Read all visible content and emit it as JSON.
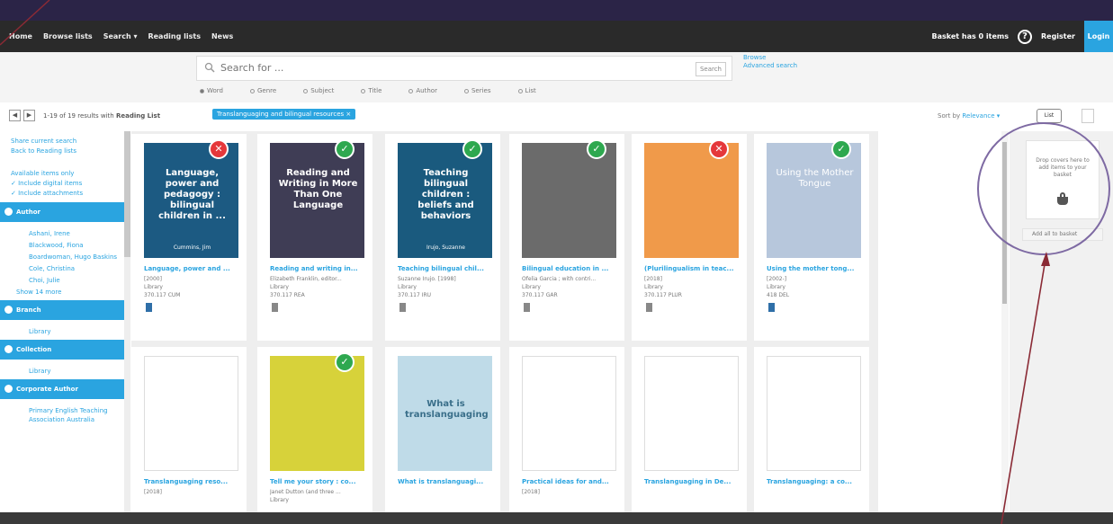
{
  "nav": {
    "home": "Home",
    "browse_lists": "Browse lists",
    "search": "Search ▾",
    "reading_lists": "Reading lists",
    "news": "News",
    "basket": "Basket has 0 items",
    "register": "Register",
    "login": "Login"
  },
  "search": {
    "placeholder": "Search for ...",
    "button": "Search",
    "browse": "Browse",
    "advanced": "Advanced search",
    "options": [
      "Word",
      "Genre",
      "Subject",
      "Title",
      "Author",
      "Series",
      "List"
    ],
    "selected": "Word"
  },
  "results": {
    "count_text": "1-19 of 19 results with",
    "filter_label": "Reading List",
    "filter_chip": "Translanguaging and bilingual resources ×",
    "sort_label": "Sort by",
    "sort_value": "Relevance ▾",
    "view_label": "List"
  },
  "sidebar": {
    "links": [
      "Share current search",
      "Back to Reading lists"
    ],
    "available_only": "Available items only",
    "checks": [
      "Include digital items",
      "Include attachments"
    ],
    "facets": [
      {
        "title": "Author",
        "items": [
          "Ashani, Irene",
          "Blackwood, Fiona",
          "Boardwoman, Hugo Baskins",
          "Cole, Christina",
          "Choi, Julie"
        ],
        "more": "Show 14 more"
      },
      {
        "title": "Branch",
        "items": [
          "Library"
        ]
      },
      {
        "title": "Collection",
        "items": [
          "Library"
        ]
      },
      {
        "title": "Corporate Author",
        "items": [
          "Primary English Teaching Association Australia"
        ]
      }
    ]
  },
  "cards_row1": [
    {
      "title": "Language, power and ...",
      "meta1": "[2000]",
      "meta2": "Library",
      "meta3": "370.117 CUM",
      "cover_text": "Language, power and pedagogy : bilingual children in ...",
      "cover_author": "Cummins, Jim",
      "status": "no",
      "cover_color": "#1c5a82"
    },
    {
      "title": "Reading and writing in...",
      "meta1": "Elizabeth Franklin, editor...",
      "meta2": "Library",
      "meta3": "370.117 REA",
      "cover_text": "Reading and Writing in More Than One Language",
      "cover_author": "",
      "status": "ok",
      "cover_color": "#3f3d55"
    },
    {
      "title": "Teaching bilingual chil...",
      "meta1": "Suzanne Irujo. [1998]",
      "meta2": "Library",
      "meta3": "370.117 IRU",
      "cover_text": "Teaching bilingual children : beliefs and behaviors",
      "cover_author": "Irujo, Suzanne",
      "status": "ok",
      "cover_color": "#1a5a7e"
    },
    {
      "title": "Bilingual education in ...",
      "meta1": "Ofelia Garcia ; with contri...",
      "meta2": "Library",
      "meta3": "370.117 GAR",
      "cover_text": "",
      "cover_author": "",
      "status": "ok",
      "cover_color": "#6b6b6b"
    },
    {
      "title": "(Plurilingualism in teac...",
      "meta1": "[2018]",
      "meta2": "Library",
      "meta3": "370.117 PLUR",
      "cover_text": "",
      "cover_author": "",
      "status": "no",
      "cover_color": "#f09a4a"
    },
    {
      "title": "Using the mother tong...",
      "meta1": "[2002-]",
      "meta2": "Library",
      "meta3": "418 DEL",
      "cover_text": "Using the Mother Tongue",
      "cover_author": "",
      "status": "ok",
      "cover_color": "#b7c7dc"
    }
  ],
  "cards_row2": [
    {
      "title": "Translanguaging reso...",
      "meta1": "[2018]",
      "status": "",
      "cover_color": "#ffffff"
    },
    {
      "title": "Tell me your story : co...",
      "meta1": "Janet Dutton (and three ...",
      "meta2": "Library",
      "status": "ok",
      "cover_color": "#d7d23a"
    },
    {
      "title": "What is translanguagi...",
      "meta1": "",
      "cover_text": "What is translanguaging",
      "status": "",
      "cover_color": "#bfdbe8"
    },
    {
      "title": "Practical ideas for and...",
      "meta1": "[2018]",
      "status": "",
      "cover_color": "#ffffff"
    },
    {
      "title": "Translanguaging in De...",
      "meta1": "",
      "status": "",
      "cover_color": "#ffffff"
    },
    {
      "title": "Translanguaging: a co...",
      "meta1": "",
      "status": "",
      "cover_color": "#ffffff"
    }
  ],
  "basket": {
    "drop_text": "Drop covers here to add items to your basket",
    "add_label": "Add all to basket"
  },
  "colors": {
    "accent": "#2aa4e0",
    "navbar": "#2a2a2a",
    "ok": "#2ea84f",
    "no": "#e5383b",
    "annotation": "#8a2a35",
    "circle": "#7e6aa3"
  }
}
